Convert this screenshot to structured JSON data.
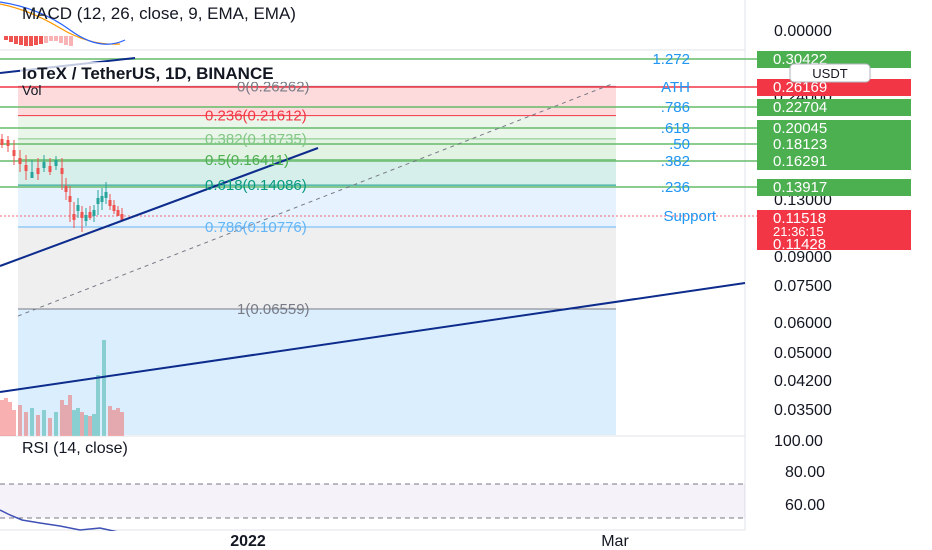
{
  "macd": {
    "label": "MACD (12, 26, close, 9, EMA, EMA)",
    "value": "0.00000"
  },
  "header": {
    "symbol": "IoTeX / TetherUS, 1D, BINANCE",
    "vol_label": "Vol",
    "currency": "USDT"
  },
  "price_axis_labels": [
    {
      "label": "0.24000",
      "value": 0.24
    },
    {
      "label": "0.13000",
      "value": 0.13
    },
    {
      "label": "0.09000",
      "value": 0.09
    },
    {
      "label": "0.07500",
      "value": 0.075
    },
    {
      "label": "0.06000",
      "value": 0.06
    },
    {
      "label": "0.05000",
      "value": 0.05
    },
    {
      "label": "0.04200",
      "value": 0.042
    },
    {
      "label": "0.03500",
      "value": 0.035
    }
  ],
  "badges": [
    {
      "label": "0.30422",
      "level": 0.30422,
      "color": "#4caf50"
    },
    {
      "label": "0.26169",
      "level": 0.26169,
      "color": "#f23645"
    },
    {
      "label": "0.22704",
      "level": 0.22704,
      "color": "#4caf50"
    },
    {
      "label": "0.20045",
      "level": 0.20045,
      "color": "#4caf50"
    },
    {
      "label": "0.18123",
      "level": 0.18123,
      "color": "#4caf50"
    },
    {
      "label": "0.16291",
      "level": 0.16291,
      "color": "#4caf50"
    },
    {
      "label": "0.13917",
      "level": 0.13917,
      "color": "#4caf50"
    }
  ],
  "price_box": {
    "price": "0.11518",
    "countdown": "21:36:15",
    "low": "0.11428",
    "color": "#f23645"
  },
  "fib_retracement": [
    {
      "ratio": "0",
      "price": 0.26262,
      "label": "0(0.26262)",
      "color": "#787b86"
    },
    {
      "ratio": "0.236",
      "price": 0.21612,
      "label": "0.236(0.21612)",
      "color": "#f23645"
    },
    {
      "ratio": "0.382",
      "price": 0.18735,
      "label": "0.382(0.18735)",
      "color": "#81c784"
    },
    {
      "ratio": "0.5",
      "price": 0.16411,
      "label": "0.5(0.16411)",
      "color": "#4caf50"
    },
    {
      "ratio": "0.618",
      "price": 0.14086,
      "label": "0.618(0.14086)",
      "color": "#089981"
    },
    {
      "ratio": "0.786",
      "price": 0.10776,
      "label": "0.786(0.10776)",
      "color": "#64b5f6"
    },
    {
      "ratio": "1",
      "price": 0.06559,
      "label": "1(0.06559)",
      "color": "#787b86"
    }
  ],
  "right_levels": [
    {
      "label": "1.272",
      "price": 0.30422
    },
    {
      "label": "ATH",
      "price": 0.26169
    },
    {
      "label": ".786",
      "price": 0.22704
    },
    {
      "label": ".618",
      "price": 0.20045
    },
    {
      "label": ".50",
      "price": 0.18123
    },
    {
      "label": ".382",
      "price": 0.16291
    },
    {
      "label": ".236",
      "price": 0.13917
    },
    {
      "label": "Support",
      "price": 0.11518
    }
  ],
  "rsi": {
    "label": "RSI (14, close)",
    "axis": [
      "100.00",
      "80.00",
      "60.00"
    ]
  },
  "time_axis": [
    "2022",
    "Mar"
  ],
  "colors": {
    "up": "#26a69a",
    "down": "#ef5350",
    "trendline": "#0d2c8c",
    "grid": "#e8e8e8"
  }
}
